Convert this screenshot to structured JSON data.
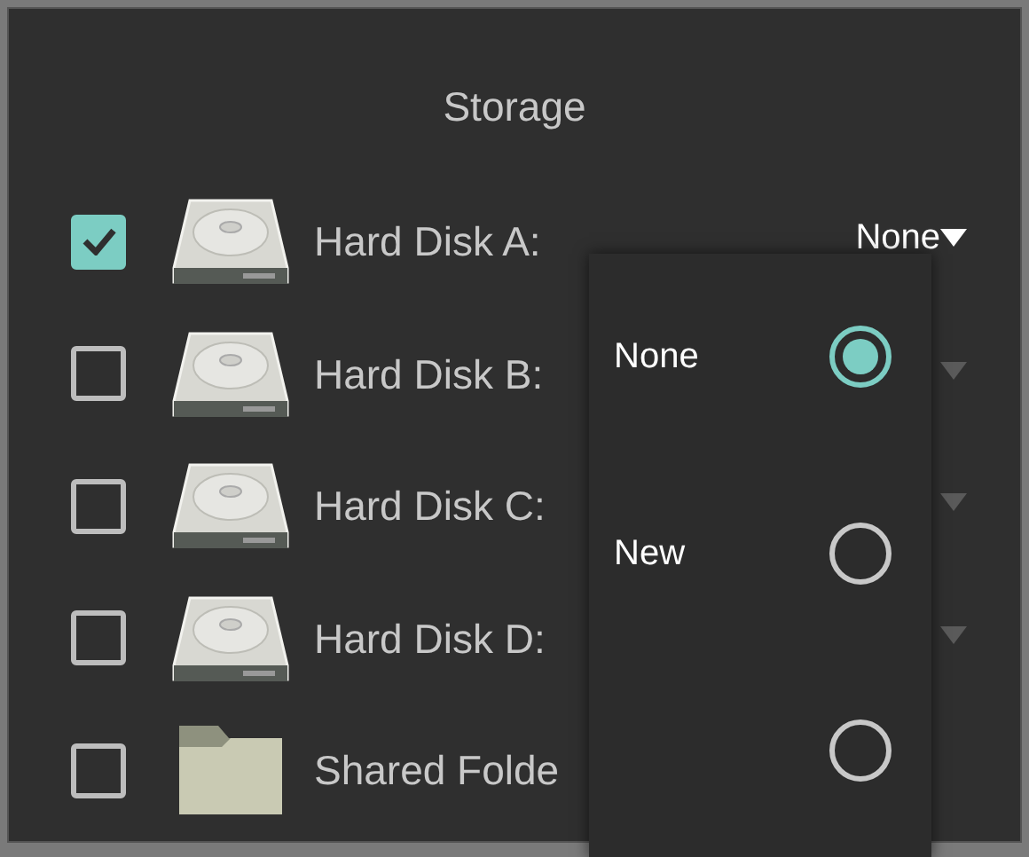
{
  "title": "Storage",
  "drives": [
    {
      "kind": "disk",
      "label": "Hard Disk A:",
      "checked": true,
      "value": "None",
      "has_dropdown": true
    },
    {
      "kind": "disk",
      "label": "Hard Disk B:",
      "checked": false,
      "has_dropdown": true
    },
    {
      "kind": "disk",
      "label": "Hard Disk C:",
      "checked": false,
      "has_dropdown": true
    },
    {
      "kind": "disk",
      "label": "Hard Disk D:",
      "checked": false,
      "has_dropdown": true
    },
    {
      "kind": "folder",
      "label": "Shared Folde",
      "checked": false,
      "has_dropdown": false
    }
  ],
  "menu": {
    "options": [
      {
        "label": "None",
        "selected": true
      },
      {
        "label": "New",
        "selected": false
      },
      {
        "selected": false
      }
    ]
  }
}
